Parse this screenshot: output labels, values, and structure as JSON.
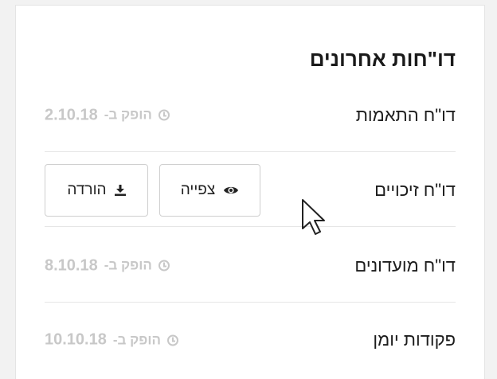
{
  "panel": {
    "title": "דו\"חות אחרונים"
  },
  "reports": [
    {
      "name": "דו\"ח התאמות",
      "meta_prefix": "הופק ב-",
      "date": "2.10.18"
    },
    {
      "name": "דו\"ח זיכויים",
      "view_label": "צפייה",
      "download_label": "הורדה"
    },
    {
      "name": "דו\"ח מועדונים",
      "meta_prefix": "הופק ב-",
      "date": "8.10.18"
    },
    {
      "name": "פקודות יומן",
      "meta_prefix": "הופק ב-",
      "date": "10.10.18"
    }
  ],
  "icons": {
    "clock": "clock-icon",
    "eye": "eye-icon",
    "download": "download-icon",
    "cursor": "mouse-pointer"
  },
  "colors": {
    "muted_text": "#c8c8c8",
    "border": "#e6e6e6",
    "text": "#1d1d1d"
  }
}
